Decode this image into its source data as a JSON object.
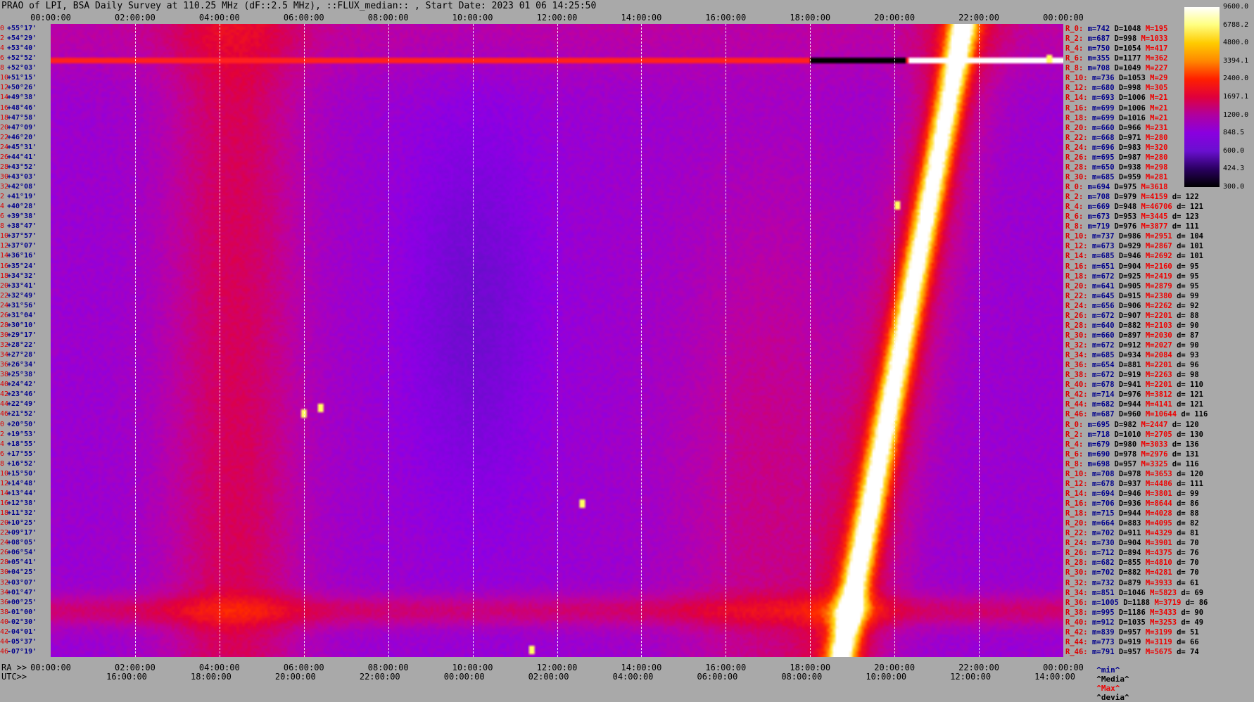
{
  "title": "PRAO of LPI, BSA Daily Survey at 110.25 MHz (dF::2.5 MHz), ::FLUX_median:: , Start Date: 2023 01 06 14:25:50",
  "top_axis_labels": [
    "00:00:00",
    "02:00:00",
    "04:00:00",
    "06:00:00",
    "08:00:00",
    "10:00:00",
    "12:00:00",
    "14:00:00",
    "16:00:00",
    "18:00:00",
    "20:00:00",
    "22:00:00",
    "00:00:00"
  ],
  "bottom_axis_caption": "RA >>",
  "bottom_axis_labels": [
    "00:00:00",
    "02:00:00",
    "04:00:00",
    "06:00:00",
    "08:00:00",
    "10:00:00",
    "12:00:00",
    "14:00:00",
    "16:00:00",
    "18:00:00",
    "20:00:00",
    "22:00:00",
    "00:00:00"
  ],
  "bottom_axis2_caption": "UTC>>",
  "bottom_axis2_labels": [
    "16:00:00",
    "18:00:00",
    "20:00:00",
    "22:00:00",
    "00:00:00",
    "02:00:00",
    "04:00:00",
    "06:00:00",
    "08:00:00",
    "10:00:00",
    "12:00:00",
    "14:00:00"
  ],
  "ra_rows": [
    {
      "i": "0",
      "dec": "+55°17'"
    },
    {
      "i": "2",
      "dec": "+54°29'"
    },
    {
      "i": "4",
      "dec": "+53°40'"
    },
    {
      "i": "6",
      "dec": "+52°52'"
    },
    {
      "i": "8",
      "dec": "+52°03'"
    },
    {
      "i": "10",
      "dec": "+51°15'"
    },
    {
      "i": "12",
      "dec": "+50°26'"
    },
    {
      "i": "14",
      "dec": "+49°38'"
    },
    {
      "i": "16",
      "dec": "+48°46'"
    },
    {
      "i": "18",
      "dec": "+47°58'"
    },
    {
      "i": "20",
      "dec": "+47°09'"
    },
    {
      "i": "22",
      "dec": "+46°20'"
    },
    {
      "i": "24",
      "dec": "+45°31'"
    },
    {
      "i": "26",
      "dec": "+44°41'"
    },
    {
      "i": "28",
      "dec": "+43°52'"
    },
    {
      "i": "30",
      "dec": "+43°03'"
    },
    {
      "i": "32",
      "dec": "+42°08'"
    },
    {
      "i": "2",
      "dec": "+41°19'"
    },
    {
      "i": "4",
      "dec": "+40°28'"
    },
    {
      "i": "6",
      "dec": "+39°38'"
    },
    {
      "i": "8",
      "dec": "+38°47'"
    },
    {
      "i": "10",
      "dec": "+37°57'"
    },
    {
      "i": "12",
      "dec": "+37°07'"
    },
    {
      "i": "14",
      "dec": "+36°16'"
    },
    {
      "i": "16",
      "dec": "+35°24'"
    },
    {
      "i": "18",
      "dec": "+34°32'"
    },
    {
      "i": "20",
      "dec": "+33°41'"
    },
    {
      "i": "22",
      "dec": "+32°49'"
    },
    {
      "i": "24",
      "dec": "+31°56'"
    },
    {
      "i": "26",
      "dec": "+31°04'"
    },
    {
      "i": "28",
      "dec": "+30°10'"
    },
    {
      "i": "30",
      "dec": "+29°17'"
    },
    {
      "i": "32",
      "dec": "+28°22'"
    },
    {
      "i": "34",
      "dec": "+27°28'"
    },
    {
      "i": "36",
      "dec": "+26°34'"
    },
    {
      "i": "38",
      "dec": "+25°38'"
    },
    {
      "i": "40",
      "dec": "+24°42'"
    },
    {
      "i": "42",
      "dec": "+23°46'"
    },
    {
      "i": "44",
      "dec": "+22°49'"
    },
    {
      "i": "46",
      "dec": "+21°52'"
    },
    {
      "i": "0",
      "dec": "+20°50'"
    },
    {
      "i": "2",
      "dec": "+19°53'"
    },
    {
      "i": "4",
      "dec": "+18°55'"
    },
    {
      "i": "6",
      "dec": "+17°55'"
    },
    {
      "i": "8",
      "dec": "+16°52'"
    },
    {
      "i": "10",
      "dec": "+15°50'"
    },
    {
      "i": "12",
      "dec": "+14°48'"
    },
    {
      "i": "14",
      "dec": "+13°44'"
    },
    {
      "i": "16",
      "dec": "+12°38'"
    },
    {
      "i": "18",
      "dec": "+11°32'"
    },
    {
      "i": "20",
      "dec": "+10°25'"
    },
    {
      "i": "22",
      "dec": "+09°17'"
    },
    {
      "i": "24",
      "dec": "+08°05'"
    },
    {
      "i": "26",
      "dec": "+06°54'"
    },
    {
      "i": "28",
      "dec": "+05°41'"
    },
    {
      "i": "30",
      "dec": "+04°25'"
    },
    {
      "i": "32",
      "dec": "+03°07'"
    },
    {
      "i": "34",
      "dec": "+01°47'"
    },
    {
      "i": "36",
      "dec": "+00°25'"
    },
    {
      "i": "38",
      "dec": "-01°00'"
    },
    {
      "i": "40",
      "dec": "-02°30'"
    },
    {
      "i": "42",
      "dec": "-04°01'"
    },
    {
      "i": "44",
      "dec": "-05°37'"
    },
    {
      "i": "46",
      "dec": "-07°19'"
    }
  ],
  "stats": [
    {
      "l": "R_0:",
      "m": "m=742",
      "d": "D=1048",
      "x": "M=195",
      "v": ""
    },
    {
      "l": "R_2:",
      "m": "m=687",
      "d": "D=998",
      "x": "M=1033",
      "v": ""
    },
    {
      "l": "R_4:",
      "m": "m=750",
      "d": "D=1054",
      "x": "M=417",
      "v": ""
    },
    {
      "l": "R_6:",
      "m": "m=355",
      "d": "D=1177",
      "x": "M=362",
      "v": ""
    },
    {
      "l": "R_8:",
      "m": "m=708",
      "d": "D=1049",
      "x": "M=227",
      "v": ""
    },
    {
      "l": "R_10:",
      "m": "m=736",
      "d": "D=1053",
      "x": "M=29",
      "v": ""
    },
    {
      "l": "R_12:",
      "m": "m=680",
      "d": "D=998",
      "x": "M=305",
      "v": ""
    },
    {
      "l": "R_14:",
      "m": "m=693",
      "d": "D=1006",
      "x": "M=21",
      "v": ""
    },
    {
      "l": "R_16:",
      "m": "m=699",
      "d": "D=1006",
      "x": "M=21",
      "v": ""
    },
    {
      "l": "R_18:",
      "m": "m=699",
      "d": "D=1016",
      "x": "M=21",
      "v": ""
    },
    {
      "l": "R_20:",
      "m": "m=660",
      "d": "D=966",
      "x": "M=231",
      "v": ""
    },
    {
      "l": "R_22:",
      "m": "m=668",
      "d": "D=971",
      "x": "M=280",
      "v": ""
    },
    {
      "l": "R_24:",
      "m": "m=696",
      "d": "D=983",
      "x": "M=320",
      "v": ""
    },
    {
      "l": "R_26:",
      "m": "m=695",
      "d": "D=987",
      "x": "M=280",
      "v": ""
    },
    {
      "l": "R_28:",
      "m": "m=650",
      "d": "D=938",
      "x": "M=298",
      "v": ""
    },
    {
      "l": "R_30:",
      "m": "m=685",
      "d": "D=959",
      "x": "M=281",
      "v": ""
    },
    {
      "l": "R_0:",
      "m": "m=694",
      "d": "D=975",
      "x": "M=3618",
      "v": ""
    },
    {
      "l": "R_2:",
      "m": "m=708",
      "d": "D=979",
      "x": "M=4159",
      "v": "d= 122"
    },
    {
      "l": "R_4:",
      "m": "m=669",
      "d": "D=948",
      "x": "M=46706",
      "v": "d= 121"
    },
    {
      "l": "R_6:",
      "m": "m=673",
      "d": "D=953",
      "x": "M=3445",
      "v": "d= 123"
    },
    {
      "l": "R_8:",
      "m": "m=719",
      "d": "D=976",
      "x": "M=3877",
      "v": "d= 111"
    },
    {
      "l": "R_10:",
      "m": "m=737",
      "d": "D=986",
      "x": "M=2951",
      "v": "d= 104"
    },
    {
      "l": "R_12:",
      "m": "m=673",
      "d": "D=929",
      "x": "M=2867",
      "v": "d= 101"
    },
    {
      "l": "R_14:",
      "m": "m=685",
      "d": "D=946",
      "x": "M=2692",
      "v": "d= 101"
    },
    {
      "l": "R_16:",
      "m": "m=651",
      "d": "D=904",
      "x": "M=2160",
      "v": "d= 95"
    },
    {
      "l": "R_18:",
      "m": "m=672",
      "d": "D=925",
      "x": "M=2419",
      "v": "d= 95"
    },
    {
      "l": "R_20:",
      "m": "m=641",
      "d": "D=905",
      "x": "M=2879",
      "v": "d= 95"
    },
    {
      "l": "R_22:",
      "m": "m=645",
      "d": "D=915",
      "x": "M=2380",
      "v": "d= 99"
    },
    {
      "l": "R_24:",
      "m": "m=656",
      "d": "D=906",
      "x": "M=2262",
      "v": "d= 92"
    },
    {
      "l": "R_26:",
      "m": "m=672",
      "d": "D=907",
      "x": "M=2201",
      "v": "d= 88"
    },
    {
      "l": "R_28:",
      "m": "m=640",
      "d": "D=882",
      "x": "M=2103",
      "v": "d= 90"
    },
    {
      "l": "R_30:",
      "m": "m=660",
      "d": "D=897",
      "x": "M=2030",
      "v": "d= 87"
    },
    {
      "l": "R_32:",
      "m": "m=672",
      "d": "D=912",
      "x": "M=2027",
      "v": "d= 90"
    },
    {
      "l": "R_34:",
      "m": "m=685",
      "d": "D=934",
      "x": "M=2084",
      "v": "d= 93"
    },
    {
      "l": "R_36:",
      "m": "m=654",
      "d": "D=881",
      "x": "M=2201",
      "v": "d= 96"
    },
    {
      "l": "R_38:",
      "m": "m=672",
      "d": "D=919",
      "x": "M=2263",
      "v": "d= 98"
    },
    {
      "l": "R_40:",
      "m": "m=678",
      "d": "D=941",
      "x": "M=2201",
      "v": "d= 110"
    },
    {
      "l": "R_42:",
      "m": "m=714",
      "d": "D=976",
      "x": "M=3812",
      "v": "d= 121"
    },
    {
      "l": "R_44:",
      "m": "m=682",
      "d": "D=944",
      "x": "M=4141",
      "v": "d= 121"
    },
    {
      "l": "R_46:",
      "m": "m=687",
      "d": "D=960",
      "x": "M=10644",
      "v": "d= 116"
    },
    {
      "l": "R_0:",
      "m": "m=695",
      "d": "D=982",
      "x": "M=2447",
      "v": "d= 120"
    },
    {
      "l": "R_2:",
      "m": "m=718",
      "d": "D=1010",
      "x": "M=2705",
      "v": "d= 130"
    },
    {
      "l": "R_4:",
      "m": "m=679",
      "d": "D=980",
      "x": "M=3033",
      "v": "d= 136"
    },
    {
      "l": "R_6:",
      "m": "m=690",
      "d": "D=978",
      "x": "M=2976",
      "v": "d= 131"
    },
    {
      "l": "R_8:",
      "m": "m=698",
      "d": "D=957",
      "x": "M=3325",
      "v": "d= 116"
    },
    {
      "l": "R_10:",
      "m": "m=708",
      "d": "D=978",
      "x": "M=3653",
      "v": "d= 120"
    },
    {
      "l": "R_12:",
      "m": "m=678",
      "d": "D=937",
      "x": "M=4486",
      "v": "d= 111"
    },
    {
      "l": "R_14:",
      "m": "m=694",
      "d": "D=946",
      "x": "M=3801",
      "v": "d= 99"
    },
    {
      "l": "R_16:",
      "m": "m=706",
      "d": "D=936",
      "x": "M=8644",
      "v": "d= 86"
    },
    {
      "l": "R_18:",
      "m": "m=715",
      "d": "D=944",
      "x": "M=4028",
      "v": "d= 88"
    },
    {
      "l": "R_20:",
      "m": "m=664",
      "d": "D=883",
      "x": "M=4095",
      "v": "d= 82"
    },
    {
      "l": "R_22:",
      "m": "m=702",
      "d": "D=911",
      "x": "M=4329",
      "v": "d= 81"
    },
    {
      "l": "R_24:",
      "m": "m=730",
      "d": "D=904",
      "x": "M=3901",
      "v": "d= 70"
    },
    {
      "l": "R_26:",
      "m": "m=712",
      "d": "D=894",
      "x": "M=4375",
      "v": "d= 76"
    },
    {
      "l": "R_28:",
      "m": "m=682",
      "d": "D=855",
      "x": "M=4810",
      "v": "d= 70"
    },
    {
      "l": "R_30:",
      "m": "m=702",
      "d": "D=882",
      "x": "M=4281",
      "v": "d= 70"
    },
    {
      "l": "R_32:",
      "m": "m=732",
      "d": "D=879",
      "x": "M=3933",
      "v": "d= 61"
    },
    {
      "l": "R_34:",
      "m": "m=851",
      "d": "D=1046",
      "x": "M=5823",
      "v": "d= 69"
    },
    {
      "l": "R_36:",
      "m": "m=1005",
      "d": "D=1188",
      "x": "M=3719",
      "v": "d= 86"
    },
    {
      "l": "R_38:",
      "m": "m=995",
      "d": "D=1186",
      "x": "M=3433",
      "v": "d= 90"
    },
    {
      "l": "R_40:",
      "m": "m=912",
      "d": "D=1035",
      "x": "M=3253",
      "v": "d= 49"
    },
    {
      "l": "R_42:",
      "m": "m=839",
      "d": "D=957",
      "x": "M=3199",
      "v": "d= 51"
    },
    {
      "l": "R_44:",
      "m": "m=773",
      "d": "D=919",
      "x": "M=3119",
      "v": "d= 66"
    },
    {
      "l": "R_46:",
      "m": "m=791",
      "d": "D=957",
      "x": "M=5675",
      "v": "d= 74"
    }
  ],
  "legend": {
    "min": "^min^",
    "median": "^Media^",
    "max": "^Max^",
    "devia": "^devia^"
  },
  "colorbar": {
    "ticks": [
      "9600.0",
      "6788.2",
      "4800.0",
      "3394.1",
      "2400.0",
      "1697.1",
      "1200.0",
      "848.5",
      "600.0",
      "424.3",
      "300.0"
    ],
    "colors": [
      "#ffffff",
      "#ffff80",
      "#ffcc00",
      "#ff8800",
      "#ff2000",
      "#e0003c",
      "#b000a0",
      "#8a00e0",
      "#6a10d0",
      "#2a0060",
      "#000000"
    ]
  },
  "chart_data": {
    "type": "heatmap",
    "title": "PRAO of LPI, BSA Daily Survey at 110.25 MHz (dF::2.5 MHz), ::FLUX_median:: , Start Date: 2023 01 06 14:25:50",
    "x_axis": "RA / UTC",
    "x_range_hours": [
      0,
      24
    ],
    "y_labels_count": 64,
    "value_scale": "log",
    "value_range": [
      300,
      9600
    ],
    "features": [
      {
        "name": "Sun track",
        "ra_start_h": 18.5,
        "ra_end_h": 21.5,
        "peak": 4800
      },
      {
        "name": "Cas A / Cyg A bright row",
        "row": "+52°52'",
        "ra_h": [
          18.0,
          23.8
        ]
      },
      {
        "name": "Galactic plane band",
        "ra_h": [
          3.0,
          6.5
        ]
      },
      {
        "name": "Low-declination band",
        "dec": "+00°25'"
      }
    ]
  }
}
